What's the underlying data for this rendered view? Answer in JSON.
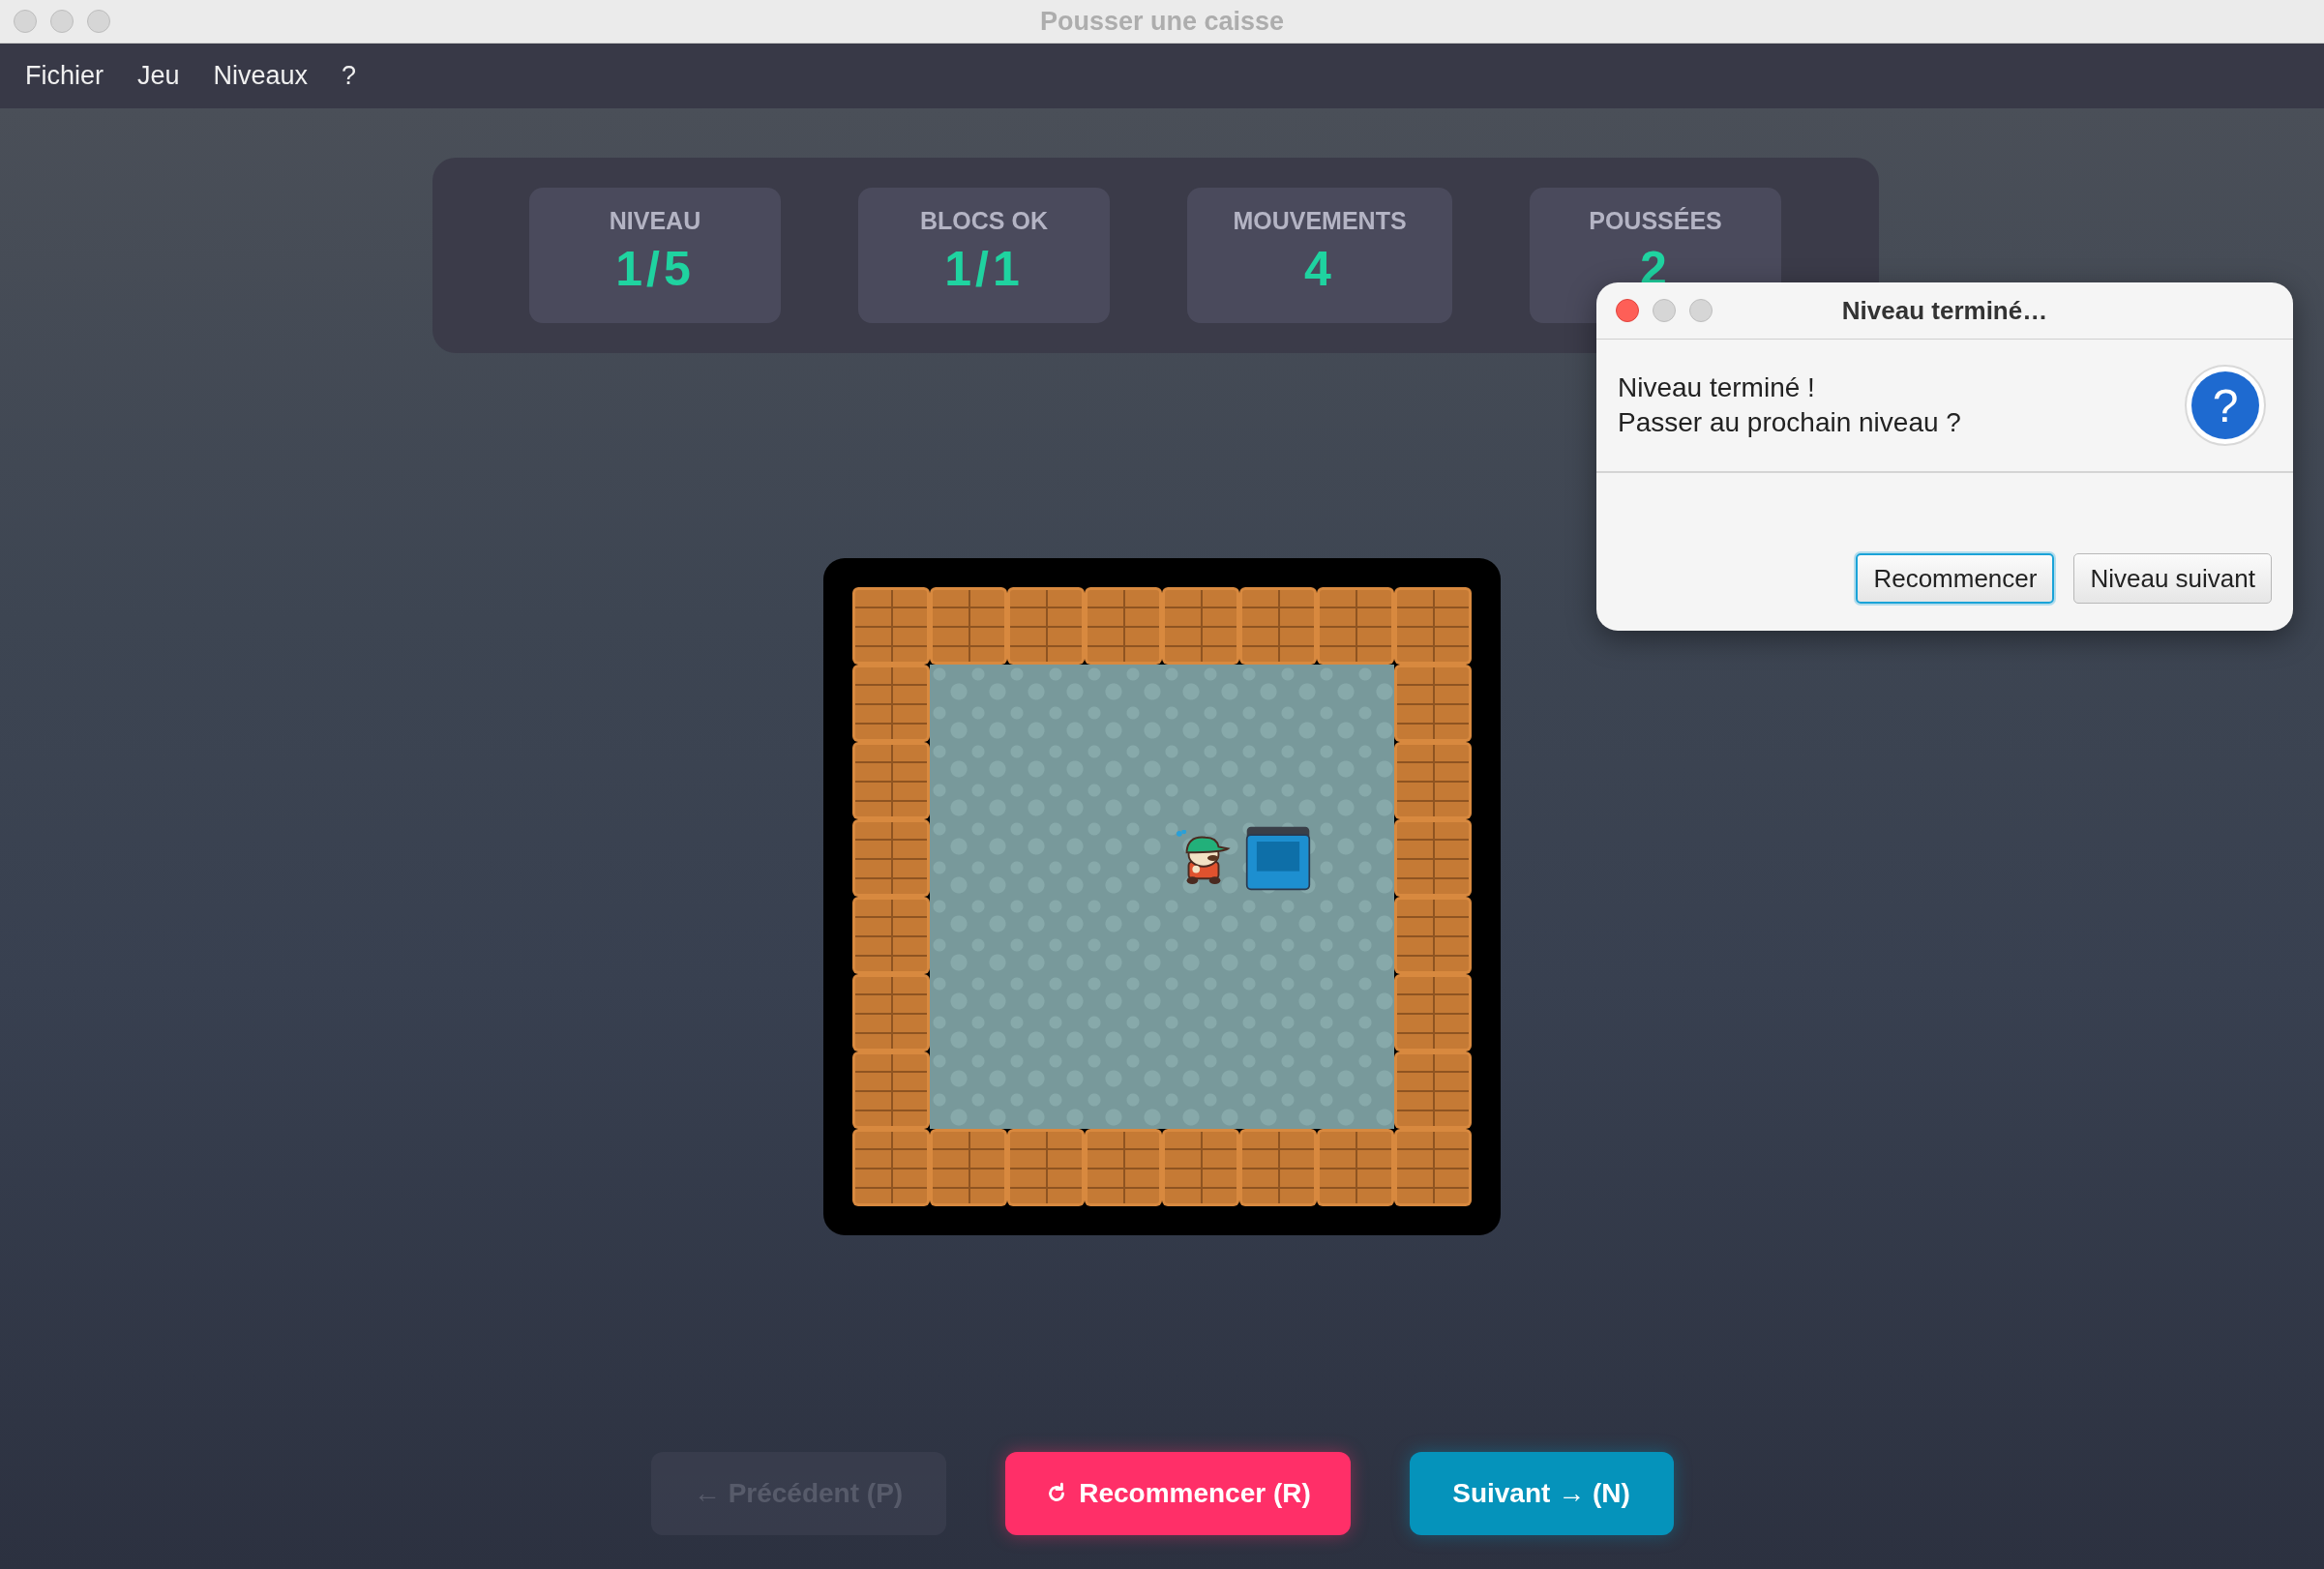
{
  "window": {
    "title": "Pousser une caisse",
    "active": false
  },
  "menu": [
    "Fichier",
    "Jeu",
    "Niveaux",
    "?"
  ],
  "stats": [
    {
      "label": "NIVEAU",
      "value": "1/5"
    },
    {
      "label": "BLOCS OK",
      "value": "1/1"
    },
    {
      "label": "MOUVEMENTS",
      "value": "4"
    },
    {
      "label": "POUSSÉES",
      "value": "2"
    }
  ],
  "board": {
    "rows": [
      [
        {
          "kind": "wall"
        },
        {
          "kind": "wall"
        },
        {
          "kind": "wall"
        },
        {
          "kind": "wall"
        },
        {
          "kind": "wall"
        },
        {
          "kind": "wall"
        },
        {
          "kind": "wall"
        },
        {
          "kind": "wall"
        }
      ],
      [
        {
          "kind": "wall"
        },
        {
          "kind": "floor"
        },
        {
          "kind": "floor"
        },
        {
          "kind": "floor"
        },
        {
          "kind": "floor"
        },
        {
          "kind": "floor"
        },
        {
          "kind": "floor"
        },
        {
          "kind": "wall"
        }
      ],
      [
        {
          "kind": "wall"
        },
        {
          "kind": "floor"
        },
        {
          "kind": "floor"
        },
        {
          "kind": "floor"
        },
        {
          "kind": "floor"
        },
        {
          "kind": "floor"
        },
        {
          "kind": "floor"
        },
        {
          "kind": "wall"
        }
      ],
      [
        {
          "kind": "wall"
        },
        {
          "kind": "floor"
        },
        {
          "kind": "floor"
        },
        {
          "kind": "floor"
        },
        {
          "kind": "player"
        },
        {
          "kind": "boxgoal"
        },
        {
          "kind": "floor"
        },
        {
          "kind": "wall"
        }
      ],
      [
        {
          "kind": "wall"
        },
        {
          "kind": "floor"
        },
        {
          "kind": "floor"
        },
        {
          "kind": "floor"
        },
        {
          "kind": "floor"
        },
        {
          "kind": "floor"
        },
        {
          "kind": "floor"
        },
        {
          "kind": "wall"
        }
      ],
      [
        {
          "kind": "wall"
        },
        {
          "kind": "floor"
        },
        {
          "kind": "floor"
        },
        {
          "kind": "floor"
        },
        {
          "kind": "floor"
        },
        {
          "kind": "floor"
        },
        {
          "kind": "floor"
        },
        {
          "kind": "wall"
        }
      ],
      [
        {
          "kind": "wall"
        },
        {
          "kind": "floor"
        },
        {
          "kind": "floor"
        },
        {
          "kind": "floor"
        },
        {
          "kind": "floor"
        },
        {
          "kind": "floor"
        },
        {
          "kind": "floor"
        },
        {
          "kind": "wall"
        }
      ],
      [
        {
          "kind": "wall"
        },
        {
          "kind": "wall"
        },
        {
          "kind": "wall"
        },
        {
          "kind": "wall"
        },
        {
          "kind": "wall"
        },
        {
          "kind": "wall"
        },
        {
          "kind": "wall"
        },
        {
          "kind": "wall"
        }
      ]
    ]
  },
  "buttons": [
    {
      "label": "← Précédent (P)",
      "kind": "previous",
      "disabled": true
    },
    {
      "label": "Recommencer (R)",
      "kind": "restart",
      "disabled": false
    },
    {
      "label": "Suivant → (N)",
      "kind": "next",
      "disabled": false
    }
  ],
  "dialog": {
    "title": "Niveau terminé…",
    "active": true,
    "message": [
      "Niveau terminé !",
      "Passer au prochain niveau ?"
    ],
    "icon_glyph": "?",
    "buttons": [
      {
        "label": "Recommencer",
        "focused": true
      },
      {
        "label": "Niveau suivant",
        "focused": false
      }
    ]
  }
}
